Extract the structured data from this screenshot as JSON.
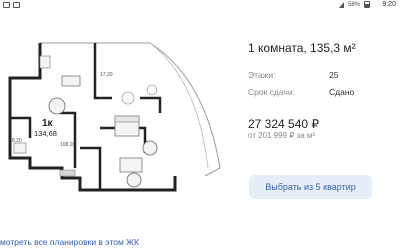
{
  "status_bar": {
    "battery": "58%",
    "time": "9:20"
  },
  "floor_plan": {
    "main_label": "1к",
    "total_area": "134,68",
    "room_areas": [
      "17,20",
      "8,20",
      "108,28"
    ]
  },
  "listing": {
    "title": "1 комната, 135,3 м²",
    "floors_label": "Этажи:",
    "floors_value": "25",
    "deadline_label": "Срок сдачи:",
    "deadline_value": "Сдано",
    "price": "27 324 540 ₽",
    "price_per_m2": "от 201 999 ₽ за м²",
    "choose_button": "Выбрать из 5 квартир",
    "all_layouts_link": "мотреть все планировки в этом ЖК"
  }
}
